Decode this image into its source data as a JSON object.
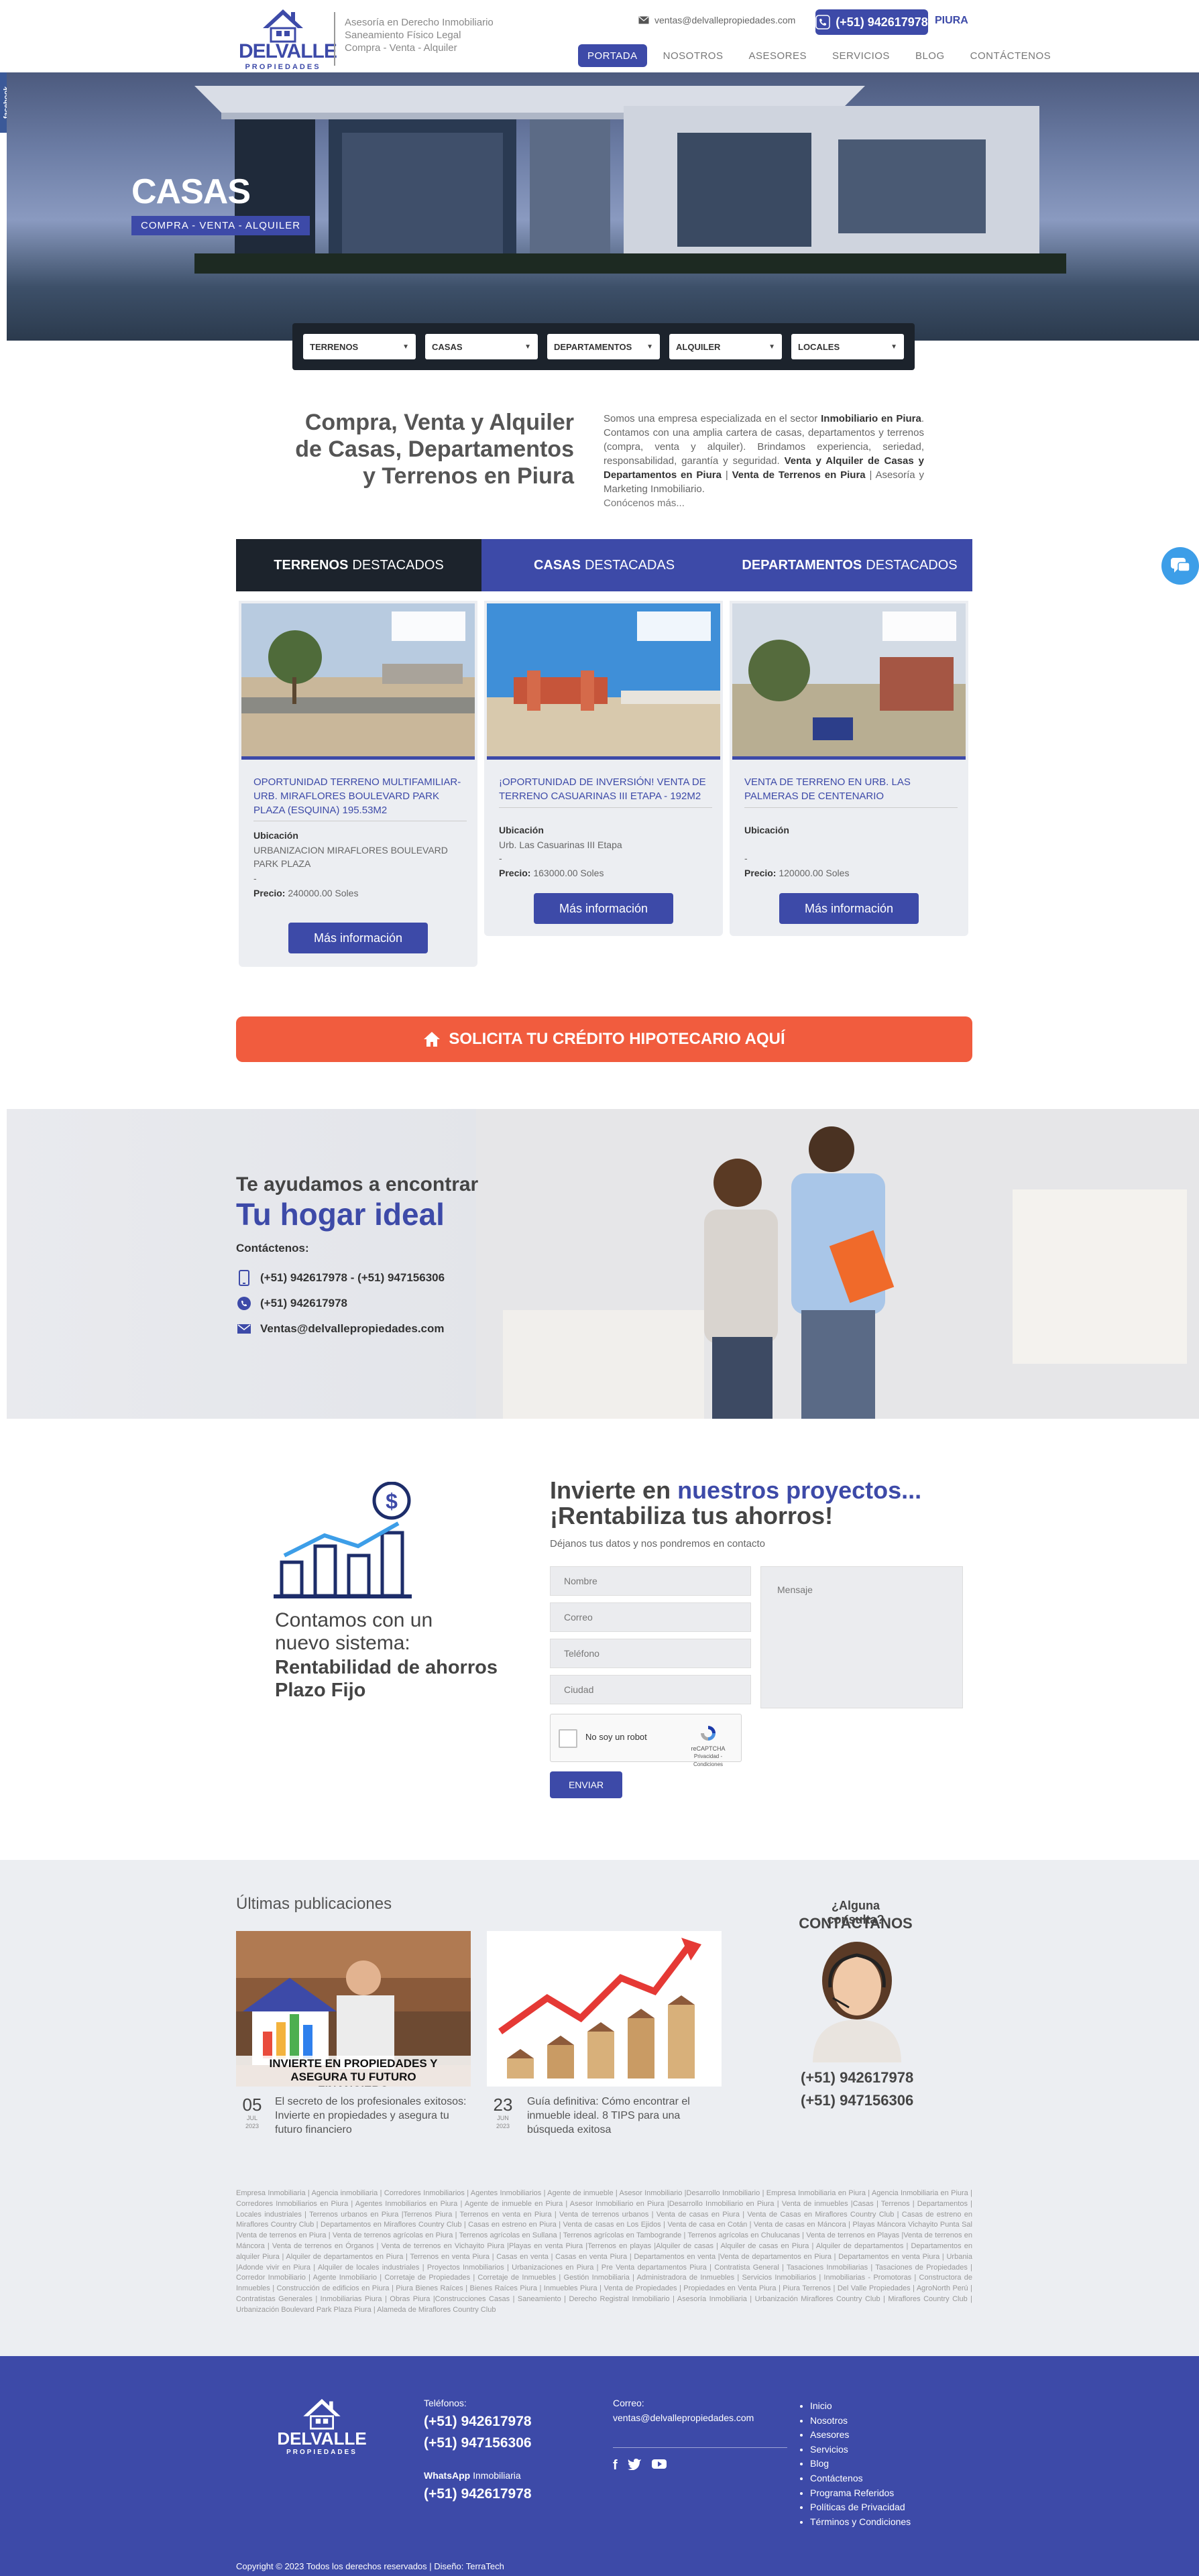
{
  "header": {
    "logo_main": "DELVALLE",
    "logo_sub": "PROPIEDADES",
    "tagline": [
      "Asesoría en Derecho Inmobiliario",
      "Saneamiento Físico Legal",
      "Compra - Venta - Alquiler"
    ],
    "email": "ventas@delvallepropiedades.com",
    "phone": "(+51) 942617978",
    "city": "PIURA",
    "nav": [
      "PORTADA",
      "NOSOTROS",
      "ASESORES",
      "SERVICIOS",
      "BLOG",
      "CONTÁCTENOS"
    ]
  },
  "side": {
    "facebook_label": "facebook"
  },
  "hero": {
    "title": "CASAS",
    "subtitle": "COMPRA - VENTA - ALQUILER"
  },
  "filters": [
    "TERRENOS",
    "CASAS",
    "DEPARTAMENTOS",
    "ALQUILER",
    "LOCALES"
  ],
  "intro": {
    "title": "Compra, Venta y Alquiler de Casas, Departamentos y Terrenos en Piura",
    "p1": "Somos una empresa especializada en el sector ",
    "b1": "Inmobiliario en Piura",
    "p2": ". Contamos con una amplia cartera de casas, departamentos y terrenos (compra, venta y alquiler). Brindamos experiencia, seriedad, responsabilidad, garantía y seguridad. ",
    "b2": "Venta y Alquiler de Casas y Departamentos en Piura",
    "p3": " | ",
    "b3": "Venta de Terrenos en Piura",
    "p4": " | Asesoría y Marketing Inmobiliario.",
    "more": "Conócenos más..."
  },
  "tabs": [
    {
      "bold": "TERRENOS",
      "rest": "DESTACADOS"
    },
    {
      "bold": "CASAS",
      "rest": "DESTACADAS"
    },
    {
      "bold": "DEPARTAMENTOS",
      "rest": "DESTACADOS"
    }
  ],
  "cards": [
    {
      "title": "OPORTUNIDAD TERRENO MULTIFAMILIAR- URB. MIRAFLORES BOULEVARD PARK PLAZA (ESQUINA) 195.53M2",
      "location_label": "Ubicación",
      "location": "URBANIZACION MIRAFLORES BOULEVARD PARK PLAZA",
      "dash": "-",
      "price_label": "Precio:",
      "price": "240000.00 Soles",
      "button": "Más información"
    },
    {
      "title": "¡OPORTUNIDAD DE INVERSIÓN! VENTA DE TERRENO CASUARINAS III ETAPA - 192M2",
      "location_label": "Ubicación",
      "location": "Urb. Las Casuarinas III Etapa",
      "dash": "-",
      "price_label": "Precio:",
      "price": "163000.00 Soles",
      "button": "Más información"
    },
    {
      "title": "VENTA DE TERRENO EN URB. LAS PALMERAS DE CENTENARIO",
      "location_label": "Ubicación",
      "location": "",
      "dash": "-",
      "price_label": "Precio:",
      "price": "120000.00 Soles",
      "button": "Más información"
    }
  ],
  "credit_button": "SOLICITA TU CRÉDITO HIPOTECARIO AQUÍ",
  "help": {
    "line1": "Te ayudamos a encontrar",
    "line2": "Tu hogar ideal",
    "contact_label": "Contáctenos:",
    "phones": "(+51) 942617978 - (+51) 947156306",
    "whatsapp": "(+51) 942617978",
    "email": "Ventas@delvallepropiedades.com"
  },
  "invest": {
    "left_line1": "Contamos con un",
    "left_line2": "nuevo sistema:",
    "left_bold1": "Rentabilidad de ahorros",
    "left_bold2": "Plazo Fijo",
    "h_part1": "Invierte en ",
    "h_part2": "nuestros proyectos...",
    "h_line2": "¡Rentabiliza tus ahorros!",
    "sub": "Déjanos tus datos y nos pondremos en contacto",
    "fields": [
      "Nombre",
      "Correo",
      "Teléfono",
      "Ciudad"
    ],
    "message": "Mensaje",
    "captcha": "No soy un robot",
    "captcha_brand": "reCAPTCHA",
    "captcha_terms": "Privacidad - Condiciones",
    "send": "ENVIAR"
  },
  "pubs": {
    "title": "Últimas publicaciones",
    "items": [
      {
        "day": "05",
        "month": "JUL",
        "year": "2023",
        "text": "El secreto de los profesionales exitosos: Invierte en propiedades y asegura tu futuro financiero",
        "img_caption": "INVIERTE EN PROPIEDADES Y ASEGURA TU FUTURO FINANCIERO"
      },
      {
        "day": "23",
        "month": "JUN",
        "year": "2023",
        "text": "Guía definitiva: Cómo encontrar el inmueble ideal. 8 TIPS para una búsqueda exitosa"
      }
    ],
    "consult_q": "¿Alguna consulta?",
    "consult_c": "CONTÁCTANOS",
    "consult_phones": [
      "(+51) 942617978",
      "(+51) 947156306"
    ]
  },
  "keywords": "Empresa Inmobiliaria | Agencia inmobiliaria | Corredores Inmobiliarios | Agentes Inmobiliarios | Agente de inmueble | Asesor Inmobiliario |Desarrollo Inmobiliario | Empresa Inmobiliaria en Piura | Agencia Inmobiliaria en Piura | Corredores Inmobiliarios en Piura | Agentes Inmobiliarios en Piura | Agente de inmueble en Piura | Asesor Inmobiliario en Piura |Desarrollo Inmobiliario en Piura | Venta de inmuebles |Casas | Terrenos | Departamentos | Locales industriales | Terrenos urbanos en Piura |Terrenos Piura | Terrenos en venta en Piura | Venta de terrenos urbanos | Venta de casas en Piura | Venta de Casas en Miraflores Country Club | Casas de estreno en Miraflores Country Club | Departamentos en Miraflores Country Club | Casas en estreno en Piura | Venta de casas en Los Ejidos | Venta de casa en Cotán | Venta de casas en Máncora | Playas Máncora Vichayito Punta Sal |Venta de terrenos en Piura | Venta de terrenos agrícolas en Piura | Terrenos agrícolas en Sullana | Terrenos agrícolas en Tambogrande | Terrenos agrícolas en Chulucanas | Venta de terrenos en Playas |Venta de terrenos en Máncora | Venta de terrenos en Órganos | Venta de terrenos en Vichayito Piura |Playas en venta Piura |Terrenos en playas |Alquiler de casas | Alquiler de casas en Piura | Alquiler de departamentos | Departamentos en alquiler Piura | Alquiler de departamentos en Piura | Terrenos en venta Piura | Casas en venta | Casas en venta Piura | Departamentos en venta |Venta de departamentos en Piura | Departamentos en venta Piura | Urbania |Adonde vivir en Piura | Alquiler de locales industriales | Proyectos Inmobiliarios | Urbanizaciones en Piura | Pre Venta departamentos Piura | Contratista General | Tasaciones Inmobiliarias | Tasaciones de Propiedades | Corredor Inmobiliario | Agente Inmobiliario | Corretaje de Propiedades | Corretaje de Inmuebles | Gestión Inmobiliaria | Administradora de Inmuebles | Servicios Inmobiliarios | Inmobiliarias - Promotoras | Constructora de Inmuebles | Construcción de edificios en Piura | Piura Bienes Raíces | Bienes Raíces Piura | Inmuebles Piura | Venta de Propiedades | Propiedades en Venta Piura | Piura Terrenos | Del Valle Propiedades | AgroNorth Perú | Contratistas Generales | Inmobiliarias Piura | Obras Piura |Construcciones Casas | Saneamiento | Derecho Registral Inmobiliario | Asesoría Inmobiliaria | Urbanización Miraflores Country Club | Miraflores Country Club | Urbanización Boulevard Park Plaza Piura | Alameda de Miraflores Country Club",
  "footer": {
    "phones_label": "Teléfonos:",
    "phones": [
      "(+51) 942617978",
      "(+51) 947156306"
    ],
    "whatsapp_bold": "WhatsApp",
    "whatsapp_rest": " Inmobiliaria",
    "whatsapp": "(+51) 942617978",
    "email_label": "Correo:",
    "email": "ventas@delvallepropiedades.com",
    "social": [
      "f",
      "t",
      "yt"
    ],
    "links": [
      "Inicio",
      "Nosotros",
      "Asesores",
      "Servicios",
      "Blog",
      "Contáctenos",
      "Programa Referidos",
      "Políticas de Privacidad",
      "Términos y Condiciones"
    ],
    "copyright": "Copyright © 2023 Todos los derechos reservados | Diseño: TerraTech"
  },
  "colors": {
    "brand": "#3d4aa8",
    "dark": "#1c232c",
    "credit": "#f15c3e",
    "footer": "#3d4aa8"
  }
}
